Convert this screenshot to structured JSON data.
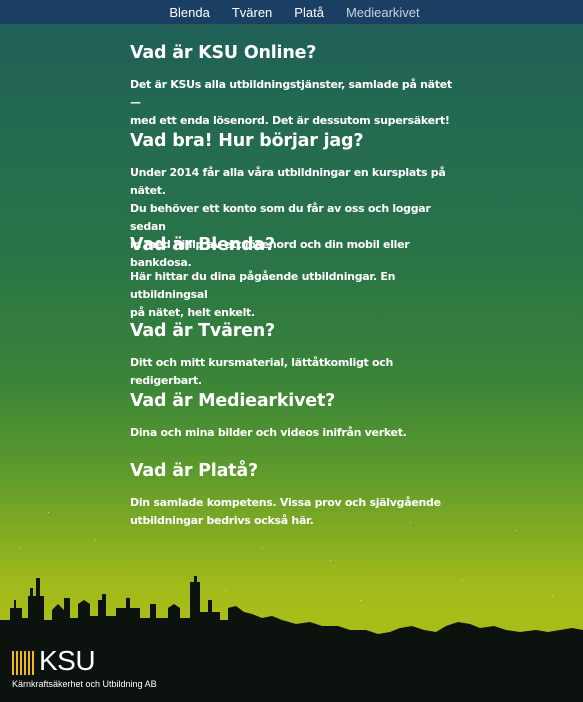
{
  "nav": {
    "items": [
      {
        "label": "Blenda"
      },
      {
        "label": "Tvären"
      },
      {
        "label": "Platå"
      },
      {
        "label": "Mediearkivet"
      }
    ]
  },
  "sections": [
    {
      "title": "Vad är KSU Online?",
      "lines": [
        "Det är KSUs alla utbildningstjänster, samlade på nätet —",
        "med ett enda lösenord. Det är dessutom supersäkert!"
      ]
    },
    {
      "title": "Vad bra! Hur börjar jag?",
      "lines": [
        "Under 2014 får alla våra utbildningar en kursplats på nätet.",
        "Du behöver ett konto som du får av oss och loggar sedan",
        "in med hjälp av ett lösenord och din mobil eller bankdosa."
      ]
    },
    {
      "title": "Vad är Blenda?",
      "lines": [
        "Här hittar du dina pågående utbildningar. En utbildningsal",
        "på nätet, helt enkelt."
      ]
    },
    {
      "title": "Vad är Tvären?",
      "lines": [
        "Ditt och mitt kursmaterial, lättåtkomligt och redigerbart."
      ]
    },
    {
      "title": "Vad är Mediearkivet?",
      "lines": [
        "Dina och mina bilder och videos inifrån verket."
      ]
    },
    {
      "title": "Vad är Platå?",
      "lines": [
        "Din samlade kompetens. Vissa prov och självgående",
        "utbildningar bedrivs också här."
      ]
    }
  ],
  "logo": {
    "text": "KSU",
    "subtitle": "Kärnkraftsäkerhet och Utbildning AB",
    "bar_color": "#f2b61e"
  },
  "colors": {
    "nav_background": "#1b3f63",
    "skyline": "#0c120d"
  }
}
